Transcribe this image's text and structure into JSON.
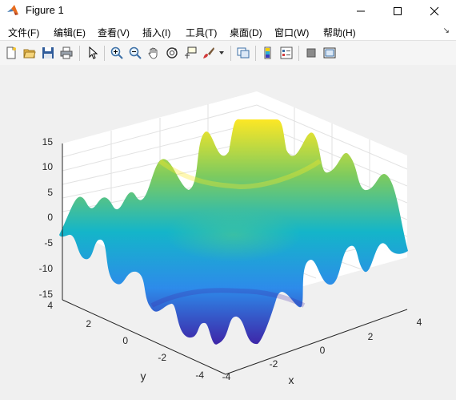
{
  "window": {
    "title": "Figure 1"
  },
  "menu": [
    {
      "label": "文件(F)"
    },
    {
      "label": "编辑(E)"
    },
    {
      "label": "查看(V)"
    },
    {
      "label": "插入(I)"
    },
    {
      "label": "工具(T)"
    },
    {
      "label": "桌面(D)"
    },
    {
      "label": "窗口(W)"
    },
    {
      "label": "帮助(H)"
    }
  ],
  "toolbar": {
    "icons": [
      "new-figure-icon",
      "open-file-icon",
      "save-icon",
      "print-icon",
      "pointer-icon",
      "zoom-in-icon",
      "zoom-out-icon",
      "pan-icon",
      "rotate-3d-icon",
      "data-cursor-icon",
      "brush-icon",
      "brush-dropdown-icon",
      "link-plot-icon",
      "colorbar-icon",
      "legend-icon",
      "hide-plot-tools-icon",
      "show-plot-tools-icon"
    ]
  },
  "colors": {
    "surface_low": "#3e26a8",
    "surface_mid": "#14b5c9",
    "surface_high": "#fde725",
    "window_bg": "#f0f0f0"
  },
  "chart_data": {
    "type": "surface",
    "title": "",
    "xlabel": "x",
    "ylabel": "y",
    "zlabel": "",
    "xlim": [
      -4,
      4
    ],
    "ylim": [
      -4,
      4
    ],
    "zlim": [
      -15,
      15
    ],
    "x_ticks": [
      "-4",
      "-2",
      "0",
      "2",
      "4"
    ],
    "y_ticks": [
      "-4",
      "-2",
      "0",
      "2",
      "4"
    ],
    "z_ticks": [
      "-15",
      "-10",
      "-5",
      "0",
      "5",
      "10",
      "15"
    ],
    "grid": true,
    "colormap": "parula"
  }
}
